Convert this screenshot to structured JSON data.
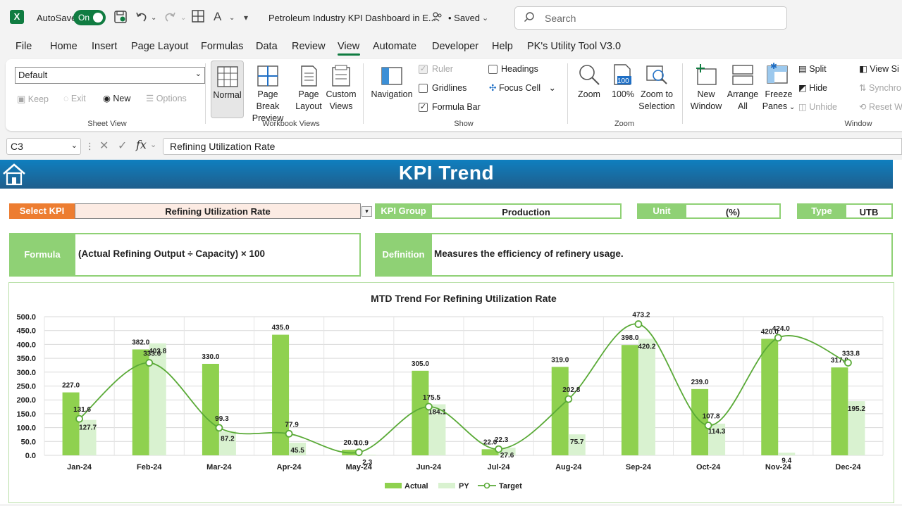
{
  "titlebar": {
    "autosave_label": "AutoSave",
    "toggle_state": "On",
    "document_title": "Petroleum Industry KPI Dashboard in E...",
    "saved_status": "• Saved",
    "search_placeholder": "Search"
  },
  "menu": [
    "File",
    "Home",
    "Insert",
    "Page Layout",
    "Formulas",
    "Data",
    "Review",
    "View",
    "Automate",
    "Developer",
    "Help",
    "PK's Utility Tool V3.0"
  ],
  "ribbon": {
    "sheet_view": {
      "dropdown_value": "Default",
      "keep": "Keep",
      "exit": "Exit",
      "new": "New",
      "options": "Options",
      "label": "Sheet View"
    },
    "workbook_views": {
      "normal": "Normal",
      "page_break_1": "Page Break",
      "page_break_2": "Preview",
      "page_layout_1": "Page",
      "page_layout_2": "Layout",
      "custom_1": "Custom",
      "custom_2": "Views",
      "label": "Workbook Views"
    },
    "show": {
      "navigation": "Navigation",
      "ruler": "Ruler",
      "gridlines": "Gridlines",
      "formula_bar": "Formula Bar",
      "headings": "Headings",
      "focus_cell": "Focus Cell",
      "label": "Show"
    },
    "zoom": {
      "zoom": "Zoom",
      "hundred": "100%",
      "hundred_badge": "100",
      "zoom_sel_1": "Zoom to",
      "zoom_sel_2": "Selection",
      "label": "Zoom"
    },
    "window": {
      "new_1": "New",
      "new_2": "Window",
      "arrange_1": "Arrange",
      "arrange_2": "All",
      "freeze_1": "Freeze",
      "freeze_2": "Panes",
      "split": "Split",
      "hide": "Hide",
      "unhide": "Unhide",
      "view_side": "View Si",
      "synch": "Synchro",
      "reset": "Reset W",
      "label": "Window"
    }
  },
  "formula_bar": {
    "name_box": "C3",
    "fx": "fx",
    "content": "Refining Utilization Rate"
  },
  "dashboard": {
    "banner_title": "KPI Trend",
    "select_kpi_label": "Select KPI",
    "select_kpi_value": "Refining Utilization Rate",
    "kpi_group_label": "KPI Group",
    "kpi_group_value": "Production",
    "unit_label": "Unit",
    "unit_value": "(%)",
    "type_label": "Type",
    "type_value": "UTB",
    "formula_label": "Formula",
    "formula_value": "(Actual Refining Output ÷ Capacity) × 100",
    "definition_label": "Definition",
    "definition_value": "Measures the efficiency of refinery usage."
  },
  "colors": {
    "excel_green": "#107c41",
    "label_orange": "#ed7d31",
    "label_green": "#8fd175",
    "kpi_fill": "#fcebe3",
    "actual": "#8fd14f",
    "py": "#d9f2d0",
    "target": "#5aaa37",
    "banner": "#1a6fa3"
  },
  "chart_data": {
    "type": "bar",
    "title": "MTD Trend For Refining Utilization Rate",
    "categories": [
      "Jan-24",
      "Feb-24",
      "Mar-24",
      "Apr-24",
      "May-24",
      "Jun-24",
      "Jul-24",
      "Aug-24",
      "Sep-24",
      "Oct-24",
      "Nov-24",
      "Dec-24"
    ],
    "series": [
      {
        "name": "Actual",
        "type": "bar",
        "values": [
          227.0,
          382.0,
          330.0,
          435.0,
          20.0,
          305.0,
          22.0,
          319.0,
          398.0,
          239.0,
          420.0,
          317.0
        ]
      },
      {
        "name": "PY",
        "type": "bar",
        "values": [
          127.7,
          403.8,
          87.2,
          45.5,
          2.3,
          184.1,
          27.6,
          75.7,
          420.2,
          114.3,
          9.4,
          195.2
        ]
      },
      {
        "name": "Target",
        "type": "line",
        "values": [
          131.6,
          333.6,
          99.3,
          77.9,
          10.9,
          175.5,
          22.3,
          202.8,
          473.2,
          107.8,
          424.0,
          333.8
        ]
      }
    ],
    "ylim": [
      0,
      500
    ],
    "yticks": [
      "0.0",
      "50.0",
      "100.0",
      "150.0",
      "200.0",
      "250.0",
      "300.0",
      "350.0",
      "400.0",
      "450.0",
      "500.0"
    ],
    "grid": true,
    "legend": "bottom"
  }
}
